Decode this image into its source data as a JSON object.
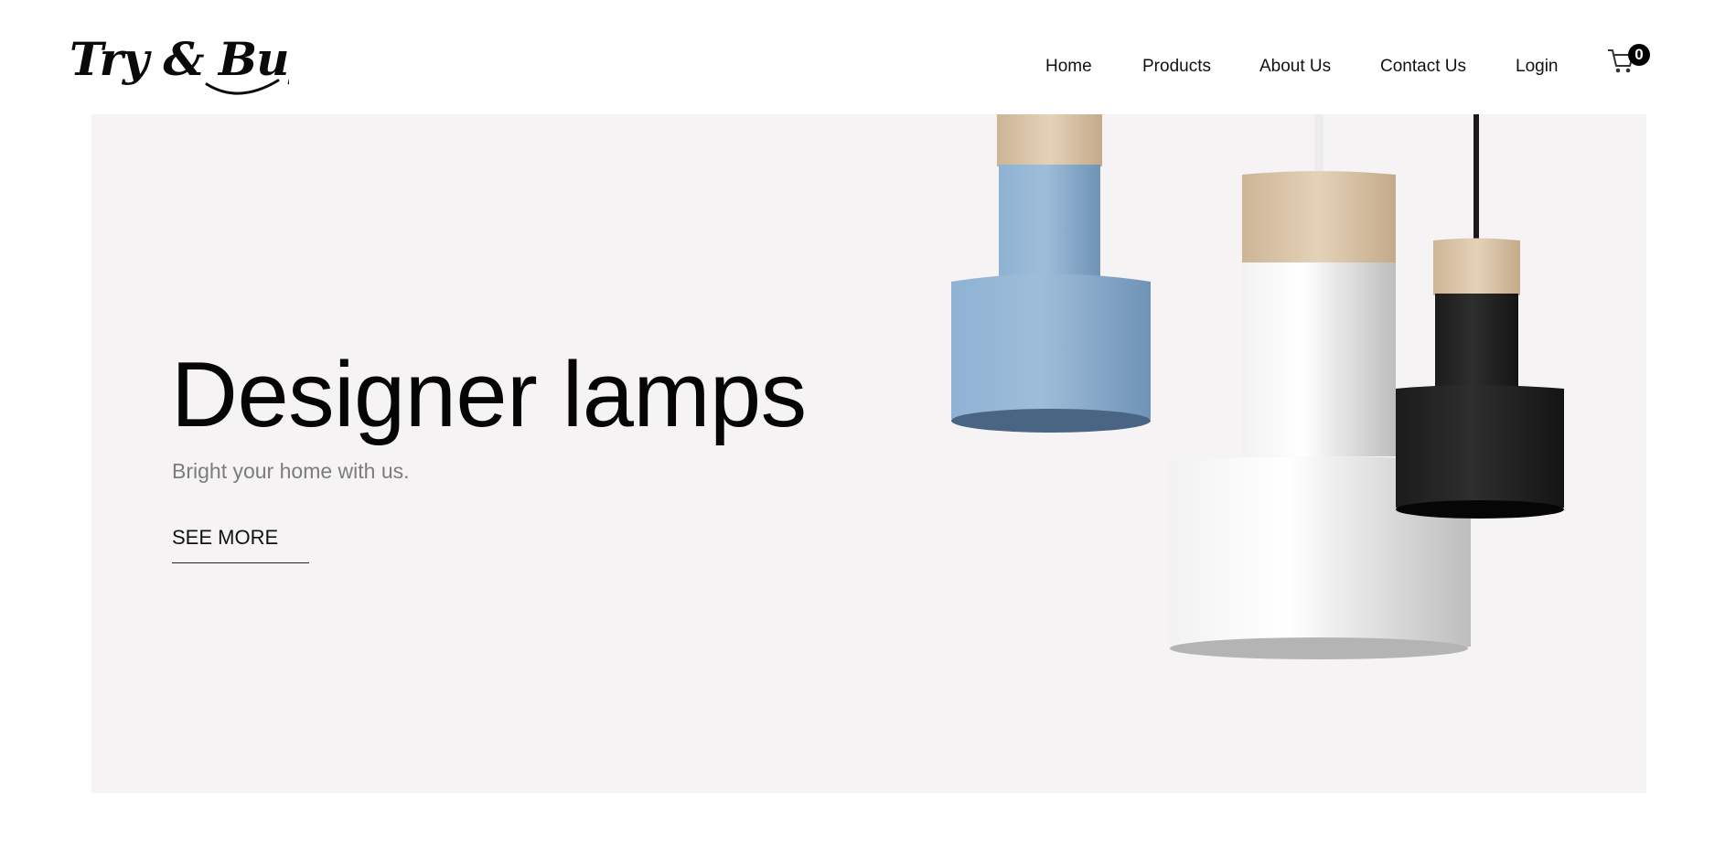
{
  "header": {
    "logo_text": "Try & Buy",
    "nav": [
      {
        "label": "Home"
      },
      {
        "label": "Products"
      },
      {
        "label": "About Us"
      },
      {
        "label": "Contact Us"
      },
      {
        "label": "Login"
      }
    ],
    "cart_count": "0",
    "cart_icon": "cart-icon"
  },
  "hero": {
    "title": "Designer lamps",
    "subtitle": "Bright your home with us.",
    "cta_label": "SEE MORE",
    "background_color": "#f5f3f3",
    "image": "pendant-lamps-blue-white-black"
  }
}
